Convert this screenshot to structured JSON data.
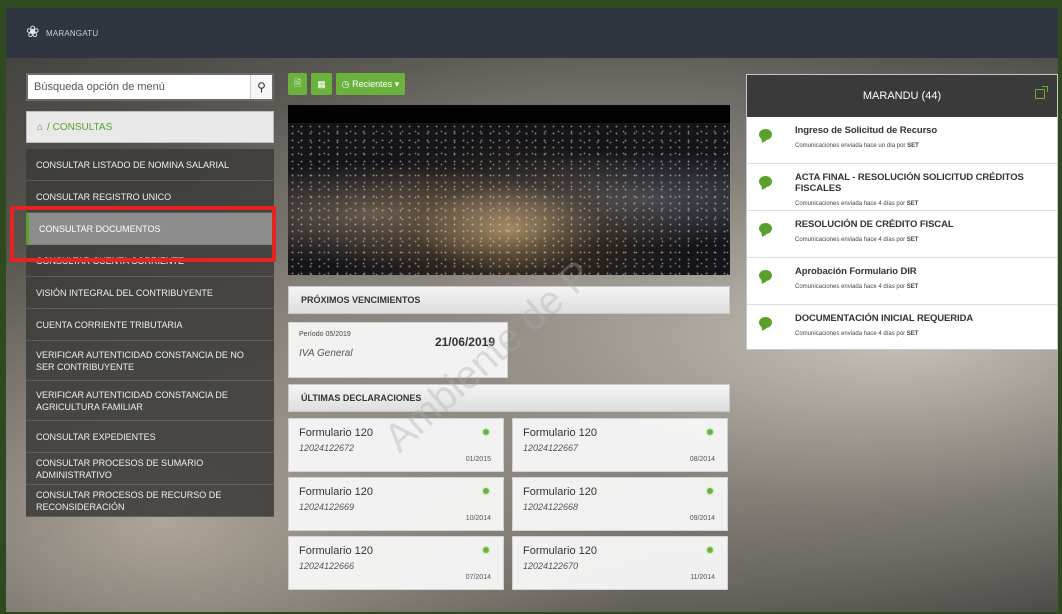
{
  "header": {
    "brand": "MARANGATU",
    "logo_icon": "flower-logo-icon"
  },
  "sidebar": {
    "search_placeholder": "Búsqueda opción de menú",
    "breadcrumb": "/ CONSULTAS",
    "items": [
      {
        "label": "CONSULTAR LISTADO DE NOMINA SALARIAL"
      },
      {
        "label": "CONSULTAR REGISTRO UNICO"
      },
      {
        "label": "CONSULTAR DOCUMENTOS"
      },
      {
        "label": "CONSULTAR CUENTA CORRIENTE"
      },
      {
        "label": "VISIÓN INTEGRAL DEL CONTRIBUYENTE"
      },
      {
        "label": "CUENTA CORRIENTE TRIBUTARIA"
      },
      {
        "label": "VERIFICAR AUTENTICIDAD CONSTANCIA DE NO SER CONTRIBUYENTE"
      },
      {
        "label": "VERIFICAR AUTENTICIDAD CONSTANCIA DE AGRICULTURA FAMILIAR"
      },
      {
        "label": "CONSULTAR EXPEDIENTES"
      },
      {
        "label": "CONSULTAR PROCESOS DE SUMARIO ADMINISTRATIVO"
      },
      {
        "label": "CONSULTAR PROCESOS DE RECURSO DE RECONSIDERACIÓN"
      }
    ]
  },
  "toolbar": {
    "recientes_label": "Recientes"
  },
  "vencimientos": {
    "title": "PRÓXIMOS VENCIMIENTOS",
    "periodo": "Período 05/2019",
    "fecha": "21/06/2019",
    "impuesto": "IVA General"
  },
  "declaraciones": {
    "title": "ÚLTIMAS DECLARACIONES",
    "items": [
      {
        "form": "Formulario 120",
        "num": "12024122672",
        "periodo": "01/2015"
      },
      {
        "form": "Formulario 120",
        "num": "12024122667",
        "periodo": "08/2014"
      },
      {
        "form": "Formulario 120",
        "num": "12024122669",
        "periodo": "10/2014"
      },
      {
        "form": "Formulario 120",
        "num": "12024122668",
        "periodo": "09/2014"
      },
      {
        "form": "Formulario 120",
        "num": "12024122666",
        "periodo": "07/2014"
      },
      {
        "form": "Formulario 120",
        "num": "12024122670",
        "periodo": "11/2014"
      }
    ]
  },
  "marandu": {
    "title": "MARANDU (44)",
    "items": [
      {
        "title": "Ingreso de Solicitud de Recurso",
        "meta": "Comunicaciones enviada hace un día por",
        "sender": "SET"
      },
      {
        "title": "ACTA FINAL - RESOLUCIÓN SOLICITUD CRÉDITOS FISCALES",
        "meta": "Comunicaciones enviada hace 4 días por",
        "sender": "SET"
      },
      {
        "title": "RESOLUCIÓN DE CRÉDITO FISCAL",
        "meta": "Comunicaciones enviada hace 4 días por",
        "sender": "SET"
      },
      {
        "title": "Aprobación Formulario DIR",
        "meta": "Comunicaciones enviada hace 4 días por",
        "sender": "SET"
      },
      {
        "title": "DOCUMENTACIÓN INICIAL REQUERIDA",
        "meta": "Comunicaciones enviada hace 4 días por",
        "sender": "SET"
      }
    ]
  },
  "watermark": "Ambiente de P",
  "colors": {
    "accent": "#6ab23c",
    "highlight": "#e8231f",
    "topbar": "#2f3640"
  }
}
